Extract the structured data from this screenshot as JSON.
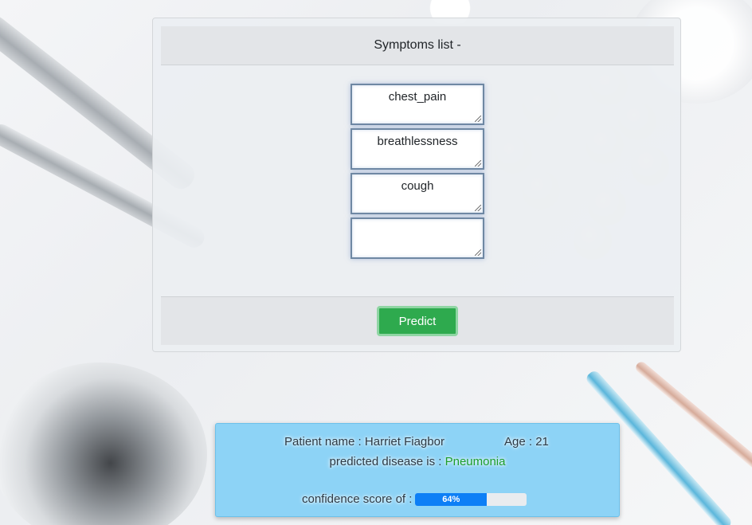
{
  "form": {
    "header": "Symptoms list -",
    "symptoms": [
      "chest_pain",
      "breathlessness",
      "cough",
      ""
    ],
    "predict_label": "Predict"
  },
  "result": {
    "patient_label": "Patient name : ",
    "patient_name": "Harriet Fiagbor",
    "age_label": "Age : ",
    "age": "21",
    "disease_label": "predicted disease is : ",
    "disease": "Pneumonia",
    "confidence_label": "confidence score of : ",
    "confidence_text": "64%",
    "confidence_value": 64
  },
  "colors": {
    "predict_button": "#2eaa4e",
    "result_panel": "#8dd3f6",
    "progress_fill": "#0d7ff6",
    "disease_text": "#1c9e2b"
  },
  "icons": [
    "scalpel-icon",
    "pills-icon",
    "stethoscope-icon",
    "syringe-icon",
    "resize-grip-icon"
  ]
}
